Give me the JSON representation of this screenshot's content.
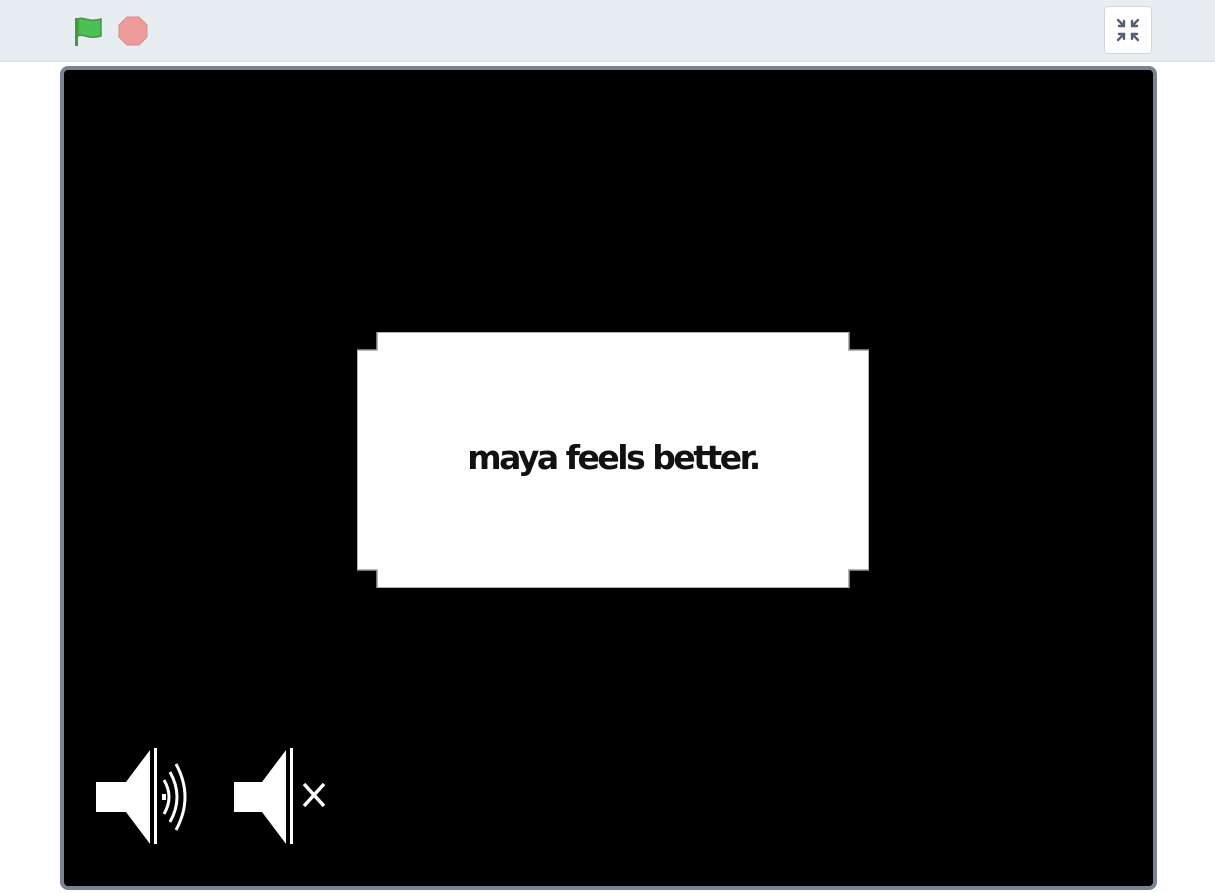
{
  "toolbar": {
    "green_flag_icon": "green-flag-icon",
    "stop_icon": "stop-sign-icon",
    "unfullscreen_icon": "unfullscreen-icon",
    "colors": {
      "background": "#e8edf1",
      "flag": "#4cbf56",
      "stop": "#ec9c9c"
    }
  },
  "stage": {
    "background_color": "#000000",
    "dialog": {
      "text": "maya feels better."
    },
    "sound_on_icon": "speaker-on-icon",
    "sound_off_icon": "speaker-mute-icon"
  }
}
